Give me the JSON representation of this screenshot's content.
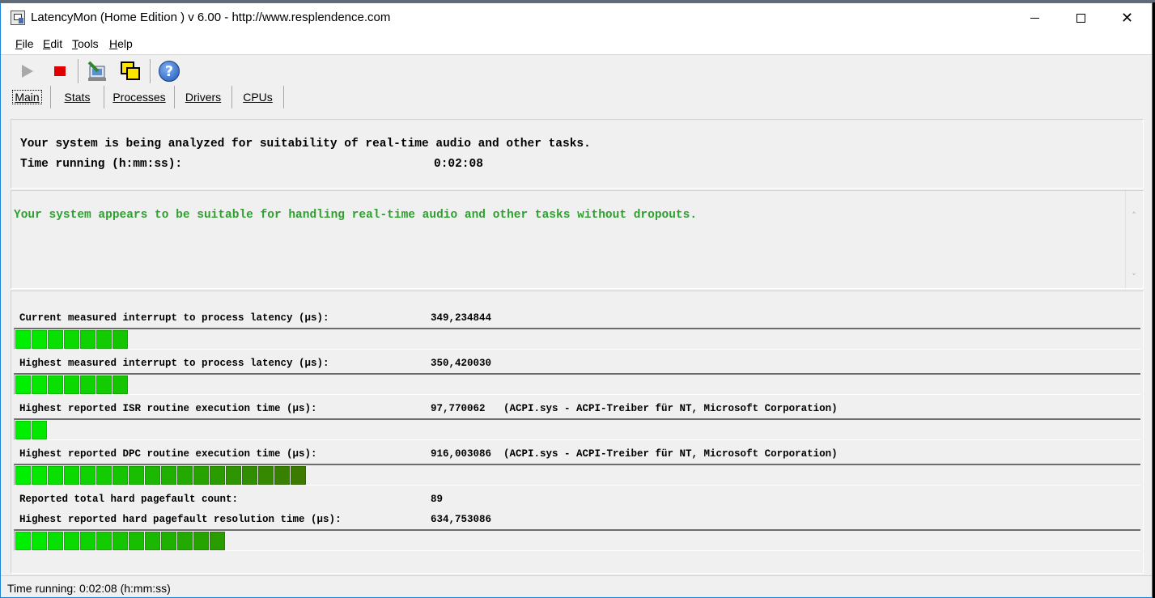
{
  "window": {
    "title": "LatencyMon  (Home Edition )  v 6.00 - http://www.resplendence.com"
  },
  "menu": {
    "items": [
      {
        "accel": "F",
        "rest": "ile"
      },
      {
        "accel": "E",
        "rest": "dit"
      },
      {
        "accel": "T",
        "rest": "ools"
      },
      {
        "accel": "H",
        "rest": "elp"
      }
    ]
  },
  "toolbar": {
    "icons": [
      "play-icon",
      "stop-icon",
      "report-icon",
      "copy-window-icon",
      "help-icon"
    ]
  },
  "tabs": [
    {
      "label": "Main",
      "active": true
    },
    {
      "label": "Stats",
      "active": false
    },
    {
      "label": "Processes",
      "active": false
    },
    {
      "label": "Drivers",
      "active": false
    },
    {
      "label": "CPUs",
      "active": false
    }
  ],
  "analysis": {
    "line1": "Your system is being analyzed for suitability of real-time audio and other tasks.",
    "time_label": "Time running (h:mm:ss):",
    "time_value": "0:02:08"
  },
  "verdict": {
    "text": "Your system appears to be suitable for handling real-time audio and other tasks without dropouts.",
    "color": "#2fa02f"
  },
  "metrics": {
    "current_latency": {
      "label": "Current measured interrupt to process latency (µs):",
      "value": "349,234844",
      "segments": 7
    },
    "highest_latency": {
      "label": "Highest measured interrupt to process latency (µs):",
      "value": "350,420030",
      "segments": 7
    },
    "isr": {
      "label": "Highest reported ISR routine execution time (µs):",
      "value": "97,770062   (ACPI.sys - ACPI-Treiber für NT, Microsoft Corporation)",
      "segments": 2
    },
    "dpc": {
      "label": "Highest reported DPC routine execution time (µs):",
      "value": "916,003086  (ACPI.sys - ACPI-Treiber für NT, Microsoft Corporation)",
      "segments": 18
    },
    "pagefault_count": {
      "label": "Reported total hard pagefault count:",
      "value": "89"
    },
    "pagefault_time": {
      "label": "Highest reported hard pagefault resolution time (µs):",
      "value": "634,753086",
      "segments": 13
    }
  },
  "colors": {
    "bar_bright": "#00ee00",
    "bar_dark": "#3c7a00"
  },
  "status": {
    "text": "Time running: 0:02:08  (h:mm:ss)"
  }
}
